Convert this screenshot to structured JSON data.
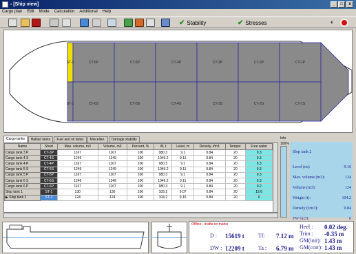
{
  "window": {
    "title": "- [Ship view]",
    "minimize": "_",
    "maximize": "□",
    "close": "x"
  },
  "menu": [
    "Cargo plan",
    "Edit",
    "Mode",
    "Calculation",
    "Additional",
    "Help"
  ],
  "toolbar": {
    "stability_label": "Stability",
    "stresses_label": "Stresses"
  },
  "shipview": {
    "upper": [
      "ST-2",
      "CT-6P",
      "CT-5P",
      "CT-4P",
      "CT-3P",
      "CT-2P",
      "CT-1P"
    ],
    "lower": [
      "ST-1",
      "CT-6S",
      "CT-5S",
      "CT-4S",
      "CT-3S",
      "CT-2S",
      "CT-1S"
    ]
  },
  "tabs": [
    "Cargo tanks",
    "Ballast tanks",
    "Fuel and oil tanks",
    "Miscellan.",
    "Damage stability"
  ],
  "table": {
    "headers": [
      "Name",
      "Short",
      "Max. volume, m3",
      "Volume, m3",
      "Percent, %",
      "W, t",
      "Level, m",
      "Density, t/m3",
      "Temper.",
      "Free water"
    ],
    "rows": [
      [
        "Cargo tank 3 P",
        "CT-3P",
        "1167",
        "1167",
        "100",
        "980.3",
        "9.1",
        "0.84",
        "20",
        "9.3"
      ],
      [
        "Cargo tank 4 S",
        "CT-4S",
        "1249",
        "1249",
        "100",
        "1049.2",
        "9.11",
        "0.84",
        "20",
        "9.3"
      ],
      [
        "Cargo tank 4 P",
        "CT-4P",
        "1167",
        "1167",
        "100",
        "980.3",
        "9.1",
        "0.84",
        "20",
        "9.3"
      ],
      [
        "Cargo tank 5 S",
        "CT-5S",
        "1249",
        "1249",
        "100",
        "1049.2",
        "9.11",
        "0.84",
        "20",
        "9.3"
      ],
      [
        "Cargo tank 5 P",
        "CT-5P",
        "1167",
        "1167",
        "100",
        "980.3",
        "9.1",
        "0.84",
        "20",
        "9.3"
      ],
      [
        "Cargo tank 6 S",
        "CT-6S",
        "1249",
        "1249",
        "100",
        "1049.2",
        "9.11",
        "0.84",
        "20",
        "9.3"
      ],
      [
        "Cargo tank 6 P",
        "CT-6P",
        "1167",
        "1167",
        "100",
        "980.3",
        "9.1",
        "0.84",
        "20",
        "9.2"
      ],
      [
        "Slop tank 1",
        "ST-1",
        "130",
        "130",
        "100",
        "109.2",
        "9.07",
        "0.84",
        "20",
        "12.6"
      ],
      [
        "Slop tank 2",
        "ST-2",
        "124",
        "124",
        "100",
        "104.2",
        "9.16",
        "0.84",
        "20",
        "0"
      ]
    ]
  },
  "info": {
    "label": "Info",
    "percent": "100%",
    "percent_value": 100,
    "title": "Slop tank 2",
    "rows": [
      {
        "label": "Level (m):",
        "value": "9.16"
      },
      {
        "label": "Max. volume (m3):",
        "value": "124"
      },
      {
        "label": "Volume (m3):",
        "value": "124"
      },
      {
        "label": "Weight (t):",
        "value": "104.2"
      },
      {
        "label": "Density (t/m3):",
        "value": "0.84"
      },
      {
        "label": "FW (m3):",
        "value": "0"
      }
    ]
  },
  "drafts": {
    "note": "Offline - drafts on marks",
    "D_label": "D :",
    "D_value": "15619 t",
    "Tf_label": "Tf:",
    "Tf_value": "7.12 m",
    "DW_label": "DW :",
    "DW_value": "12209 t",
    "Ta_label": "Ta :",
    "Ta_value": "6.79 m",
    "heel_label": "Heel :",
    "heel_value": "0.02 deg.",
    "trim_label": "Trim :",
    "trim_value": "-0.35 m",
    "gmi_label": "GM(init):",
    "gmi_value": "1.43 m",
    "gmc_label": "GM(corr):",
    "gmc_value": "1.43 m"
  },
  "colors": {
    "tank_fill": "#8a8a8a",
    "tank_grid": "#2a2aa0",
    "slop_fill": "#f0e000",
    "info_bg": "#a9d5ea",
    "fw_cell": "#7ee5e5"
  }
}
